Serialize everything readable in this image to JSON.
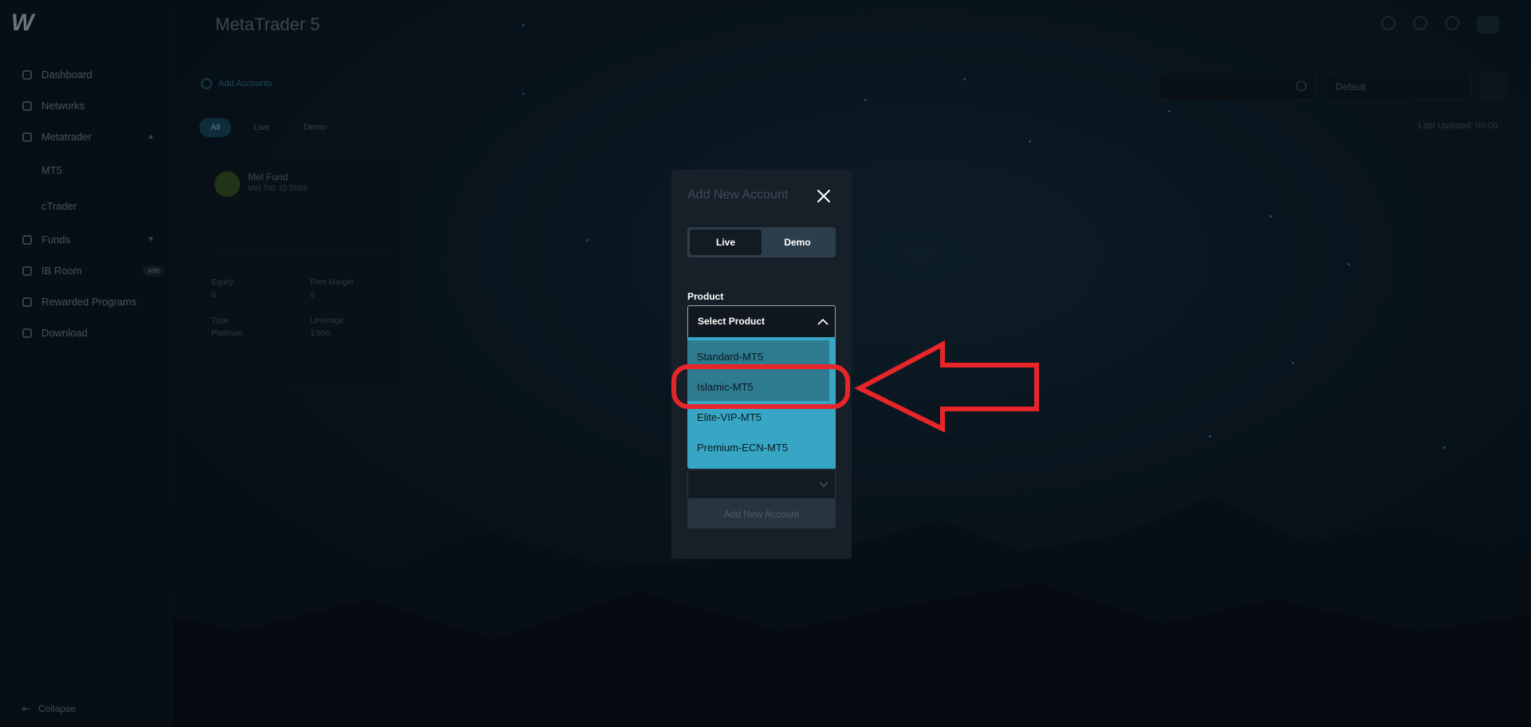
{
  "app": {
    "logo_text": "W",
    "header_title": "MetaTrader 5"
  },
  "sidebar": {
    "items": [
      {
        "label": "Dashboard",
        "icon": "grid-icon"
      },
      {
        "label": "Networks",
        "icon": "network-icon"
      },
      {
        "label": "Metatrader",
        "icon": "chart-icon"
      },
      {
        "label": "MT5",
        "icon": ""
      },
      {
        "label": "cTrader",
        "icon": ""
      },
      {
        "label": "Funds",
        "icon": "wallet-icon"
      },
      {
        "label": "IB Room",
        "icon": "users-icon",
        "badge": "Affil"
      },
      {
        "label": "Rewarded Programs",
        "icon": "gift-icon"
      },
      {
        "label": "Download",
        "icon": "download-icon"
      }
    ],
    "collapse_label": "Collapse"
  },
  "page": {
    "breadcrumb": "Add Accounts",
    "filters": [
      "All",
      "Live",
      "Demo"
    ],
    "view_select": "Default",
    "last_updated": "Last Updated: 00:00",
    "card": {
      "name": "Mel Fund",
      "meta": "Mel Trd. ID 5693",
      "fields": [
        {
          "k": "Equity",
          "v": "0"
        },
        {
          "k": "Free Margin",
          "v": "0"
        },
        {
          "k": "Type",
          "v": "Platinum"
        },
        {
          "k": "Leverage",
          "v": "1:500"
        }
      ]
    }
  },
  "modal": {
    "title": "Add New Account",
    "tabs": [
      {
        "label": "Live",
        "active": true
      },
      {
        "label": "Demo",
        "active": false
      }
    ],
    "product_label": "Product",
    "product_placeholder": "Select Product",
    "options": [
      "Standard-MT5",
      "Islamic-MT5",
      "Elite-VIP-MT5",
      "Premium-ECN-MT5"
    ],
    "highlighted_options": [
      "Standard-MT5",
      "Islamic-MT5"
    ],
    "submit_label": "Add New Account"
  },
  "colors": {
    "accent": "#36a6c4",
    "annotation": "#e8262a",
    "modal_bg": "#172029"
  }
}
